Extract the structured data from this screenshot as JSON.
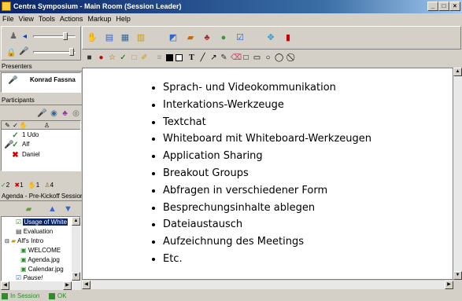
{
  "window": {
    "title": "Centra Symposium - Main Room (Session Leader)",
    "buttons": [
      "_",
      "□",
      "×"
    ]
  },
  "menu": [
    "File",
    "View",
    "Tools",
    "Actions",
    "Markup",
    "Help"
  ],
  "presenters": {
    "label": "Presenters",
    "name": "Konrad Fassna"
  },
  "participants": {
    "label": "Participants",
    "list": [
      {
        "text": "1 Udo"
      },
      {
        "text": "Alf"
      },
      {
        "text": "Daniel"
      }
    ],
    "counts": {
      "check": "2",
      "x": "1",
      "hand": "1",
      "people": "4"
    }
  },
  "agenda": {
    "label": "Agenda - Pre-Kickoff Session",
    "items": [
      {
        "text": "Usage of White"
      },
      {
        "text": "Evaluation"
      },
      {
        "text": "Alf's Intro"
      },
      {
        "text": "WELCOME"
      },
      {
        "text": "Agenda.jpg"
      },
      {
        "text": "Calendar.jpg"
      },
      {
        "text": "Pause!"
      }
    ]
  },
  "whiteboard": {
    "bullets": [
      "Sprach- und Videokommunikation",
      "Interkations-Werkzeuge",
      "Textchat",
      "Whiteboard mit Whiteboard-Werkzeugen",
      "Application Sharing",
      "Breakout Groups",
      "Abfragen in verschiedener Form",
      "Besprechungsinhalte ablegen",
      "Dateiaustausch",
      "Aufzeichnung des Meetings",
      "Etc."
    ]
  },
  "markup_tools": {
    "text_tool": "T"
  },
  "status": {
    "session": "In Session",
    "ok": "OK"
  },
  "colors": {
    "title_start": "#0a246a",
    "title_end": "#a6caf0",
    "status_green": "#2e8b2e"
  }
}
